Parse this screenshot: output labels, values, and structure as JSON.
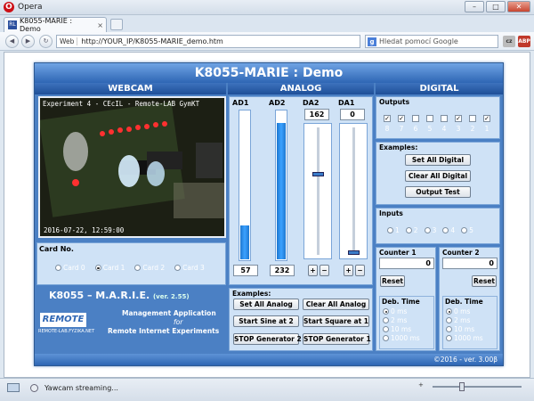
{
  "window": {
    "app_name": "Opera"
  },
  "tab": {
    "title": "K8055-MARIE : Demo",
    "close": "×"
  },
  "address": {
    "web_label": "Web",
    "url": "http://YOUR_IP/K8055-MARIE_demo.htm"
  },
  "search": {
    "placeholder": "Hledat pomocí Google"
  },
  "app": {
    "title": "K8055-MARIE : Demo",
    "sections": {
      "webcam": "WEBCAM",
      "analog": "ANALOG",
      "digital": "DIGITAL"
    },
    "webcam": {
      "caption": "Experiment 4 - CEcIL - Remote-LAB GymKT",
      "timestamp": "2016-07-22, 12:59:00"
    },
    "card": {
      "legend": "Card No.",
      "options": [
        "Card 0",
        "Card 1",
        "Card 2",
        "Card 3"
      ],
      "selected": 1
    },
    "brand": {
      "name": "K8055 – M.A.R.I.E.",
      "version": "(ver. 2.55)",
      "line1": "Management Application",
      "line2": "for",
      "line3": "Remote Internet Experiments",
      "logo_text": "REMOTE",
      "logo_sub": "REMOTE-LAB.FYZIKA.NET"
    },
    "analog": {
      "ad1": {
        "label": "AD1",
        "value": "57",
        "level": 0.224
      },
      "ad2": {
        "label": "AD2",
        "value": "232",
        "level": 0.91
      },
      "da2": {
        "label": "DA2",
        "value": "162",
        "level": 0.635
      },
      "da1": {
        "label": "DA1",
        "value": "0",
        "level": 0.0
      },
      "plus": "+",
      "minus": "−"
    },
    "analog_examples": {
      "legend": "Examples:",
      "buttons": [
        "Set All Analog",
        "Clear All Analog",
        "Start Sine at 2",
        "Start Square at 1",
        "STOP Generator 2",
        "STOP Generator 1"
      ]
    },
    "outputs": {
      "legend": "Outputs",
      "labels": [
        "8",
        "7",
        "6",
        "5",
        "4",
        "3",
        "2",
        "1"
      ],
      "checked": [
        true,
        true,
        false,
        false,
        false,
        true,
        false,
        true
      ]
    },
    "digital_examples": {
      "legend": "Examples:",
      "buttons": [
        "Set All Digital",
        "Clear All Digital",
        "Output Test"
      ]
    },
    "inputs": {
      "legend": "Inputs",
      "labels": [
        "1",
        "2",
        "3",
        "4",
        "5"
      ]
    },
    "counter1": {
      "legend": "Counter 1",
      "value": "0",
      "reset": "Reset",
      "deb_legend": "Deb. Time",
      "options": [
        "0 ms",
        "2 ms",
        "10 ms",
        "1000 ms"
      ],
      "selected": 0
    },
    "counter2": {
      "legend": "Counter 2",
      "value": "0",
      "reset": "Reset",
      "deb_legend": "Deb. Time",
      "options": [
        "0 ms",
        "2 ms",
        "10 ms",
        "1000 ms"
      ],
      "selected": 0
    },
    "footer": "©2016 - ver. 3.00β"
  },
  "status": {
    "text": "Yawcam streaming...",
    "zoom_icon": "+"
  }
}
